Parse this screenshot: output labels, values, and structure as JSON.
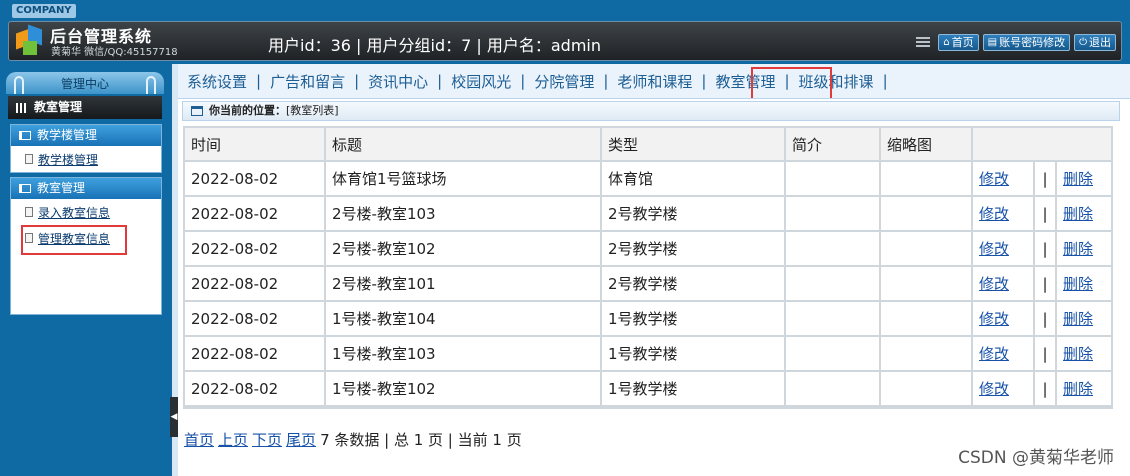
{
  "header": {
    "company": "COMPANY",
    "title": "后台管理系统",
    "subtitle": "黄菊华 微信/QQ:45157718",
    "user_info": "用户id：36 | 用户分组id：7 | 用户名：admin",
    "buttons": [
      {
        "icon": "home-icon",
        "label": "首页"
      },
      {
        "icon": "list-icon",
        "label": "账号密码修改"
      },
      {
        "icon": "power-icon",
        "label": "退出"
      }
    ]
  },
  "sidebar": {
    "head": "管理中心",
    "current": "教室管理",
    "groups": [
      {
        "title": "教学楼管理",
        "items": [
          "教学楼管理"
        ]
      },
      {
        "title": "教室管理",
        "items": [
          "录入教室信息",
          "管理教室信息"
        ]
      }
    ]
  },
  "nav": [
    "系统设置",
    "广告和留言",
    "资讯中心",
    "校园风光",
    "分院管理",
    "老师和课程",
    "教室管理",
    "班级和排课"
  ],
  "location": {
    "label": "你当前的位置：",
    "value": "[教室列表]"
  },
  "table": {
    "headers": [
      "时间",
      "标题",
      "类型",
      "简介",
      "缩略图",
      ""
    ],
    "edit_label": "修改",
    "delete_label": "删除",
    "divider": "|",
    "rows": [
      {
        "date": "2022-08-02",
        "title": "体育馆1号篮球场",
        "type": "体育馆",
        "intro": "",
        "thumb": ""
      },
      {
        "date": "2022-08-02",
        "title": "2号楼-教室103",
        "type": "2号教学楼",
        "intro": "",
        "thumb": ""
      },
      {
        "date": "2022-08-02",
        "title": "2号楼-教室102",
        "type": "2号教学楼",
        "intro": "",
        "thumb": ""
      },
      {
        "date": "2022-08-02",
        "title": "2号楼-教室101",
        "type": "2号教学楼",
        "intro": "",
        "thumb": ""
      },
      {
        "date": "2022-08-02",
        "title": "1号楼-教室104",
        "type": "1号教学楼",
        "intro": "",
        "thumb": ""
      },
      {
        "date": "2022-08-02",
        "title": "1号楼-教室103",
        "type": "1号教学楼",
        "intro": "",
        "thumb": ""
      },
      {
        "date": "2022-08-02",
        "title": "1号楼-教室102",
        "type": "1号教学楼",
        "intro": "",
        "thumb": ""
      }
    ]
  },
  "pager": {
    "first": "首页",
    "prev": "上页",
    "next": "下页",
    "last": "尾页",
    "summary": "7 条数据 | 总 1 页 | 当前 1 页"
  },
  "watermark": "CSDN @黄菊华老师",
  "colors": {
    "header": "#0f6aa3",
    "link": "#1752a8",
    "highlight": "#e03a3a"
  }
}
